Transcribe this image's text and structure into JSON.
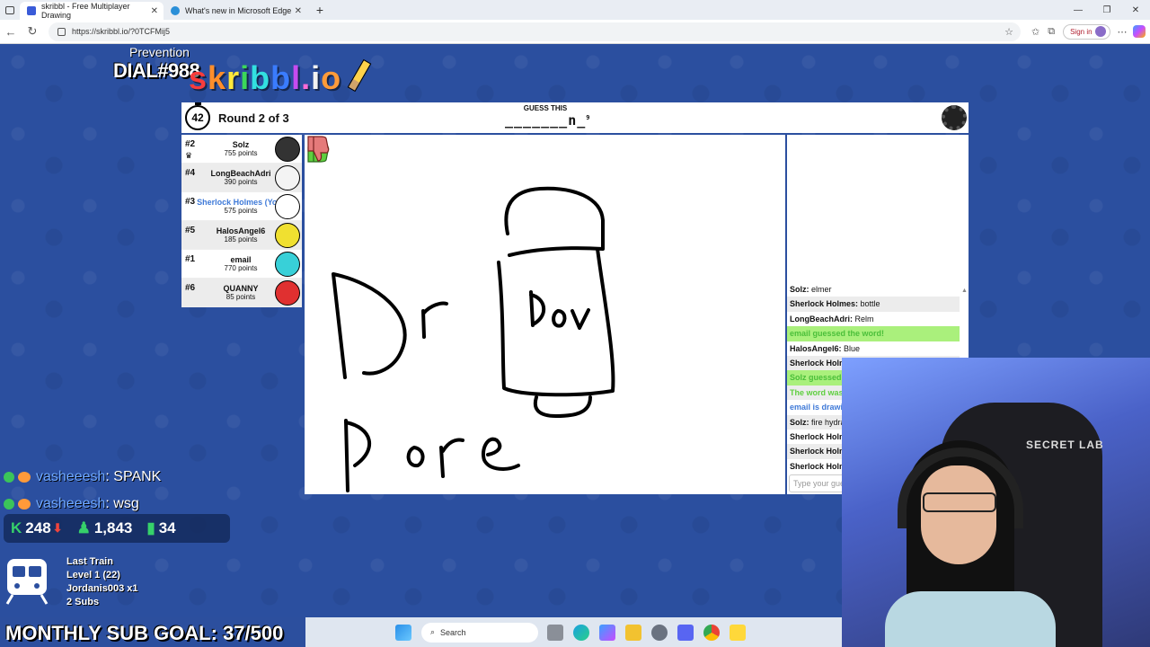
{
  "browser": {
    "tabs": [
      {
        "title": "skribbl - Free Multiplayer Drawing",
        "active": true,
        "favicon_color": "#3a5bd8"
      },
      {
        "title": "What's new in Microsoft Edge",
        "active": false,
        "favicon_color": "#2a8fd8"
      }
    ],
    "url": "https://skribbl.io/?0TCFMij5",
    "sign_in_label": "Sign in"
  },
  "overlay": {
    "prevention": "Prevention",
    "dial": "DIAL#988",
    "logo_letters": [
      "s",
      "k",
      "r",
      "i",
      "b",
      "b",
      "l",
      ".",
      "i",
      "o"
    ]
  },
  "game": {
    "timer": "42",
    "round_label": "Round 2 of 3",
    "guess_label": "GUESS THIS",
    "word_hint": "_______n_",
    "word_length": "9"
  },
  "players": [
    {
      "rank": "#2",
      "name": "Solz",
      "points": "755 points",
      "avatar_color": "#333333",
      "crown": true,
      "me": false
    },
    {
      "rank": "#4",
      "name": "LongBeachAdri",
      "points": "390 points",
      "avatar_color": "#f4f4f4",
      "crown": false,
      "me": false
    },
    {
      "rank": "#3",
      "name": "Sherlock Holmes (You)",
      "points": "575 points",
      "avatar_color": "#ffffff",
      "crown": false,
      "me": true
    },
    {
      "rank": "#5",
      "name": "HalosAngel6",
      "points": "185 points",
      "avatar_color": "#f0e030",
      "crown": false,
      "me": false
    },
    {
      "rank": "#1",
      "name": "email",
      "points": "770 points",
      "avatar_color": "#38d0d8",
      "crown": false,
      "me": false
    },
    {
      "rank": "#6",
      "name": "QUANNY",
      "points": "85 points",
      "avatar_color": "#e03030",
      "crown": false,
      "me": false
    }
  ],
  "chat": {
    "messages": [
      {
        "user": "Solz",
        "text": "elmer",
        "style": "normal"
      },
      {
        "user": "Sherlock Holmes",
        "text": "bottle",
        "style": "normal"
      },
      {
        "user": "LongBeachAdri",
        "text": "Relm",
        "style": "normal"
      },
      {
        "user": "",
        "text": "email guessed the word!",
        "style": "green"
      },
      {
        "user": "HalosAngel6",
        "text": "Blue",
        "style": "normal"
      },
      {
        "user": "Sherlock Holmes",
        "text": "",
        "style": "normal"
      },
      {
        "user": "",
        "text": "Solz guessed the word!",
        "style": "green"
      },
      {
        "user": "",
        "text": "The word was",
        "style": "green2"
      },
      {
        "user": "",
        "text": "email is drawing now!",
        "style": "blue"
      },
      {
        "user": "Solz",
        "text": "fire hydrant",
        "style": "normal"
      },
      {
        "user": "Sherlock Holmes",
        "text": "",
        "style": "normal"
      },
      {
        "user": "Sherlock Holmes",
        "text": "",
        "style": "normal"
      },
      {
        "user": "Sherlock Holmes",
        "text": "",
        "style": "normal"
      }
    ],
    "input_placeholder": "Type your guess here..."
  },
  "stream": {
    "chat_lines": [
      {
        "user": "vasheeesh",
        "text": ": SPANK"
      },
      {
        "user": "vasheeesh",
        "text": ": wsg"
      }
    ],
    "stat_kick": "248",
    "stat_follow": "1,843",
    "stat_viewers": "34",
    "last_train": "Last Train",
    "level": "Level 1  (22)",
    "train_user": "Jordanis003 x1",
    "subs": "2 Subs",
    "sub_goal": "MONTHLY SUB GOAL: 37/500"
  },
  "taskbar": {
    "search_label": "Search"
  },
  "webcam": {
    "chair_brand": "SECRET LAB"
  }
}
